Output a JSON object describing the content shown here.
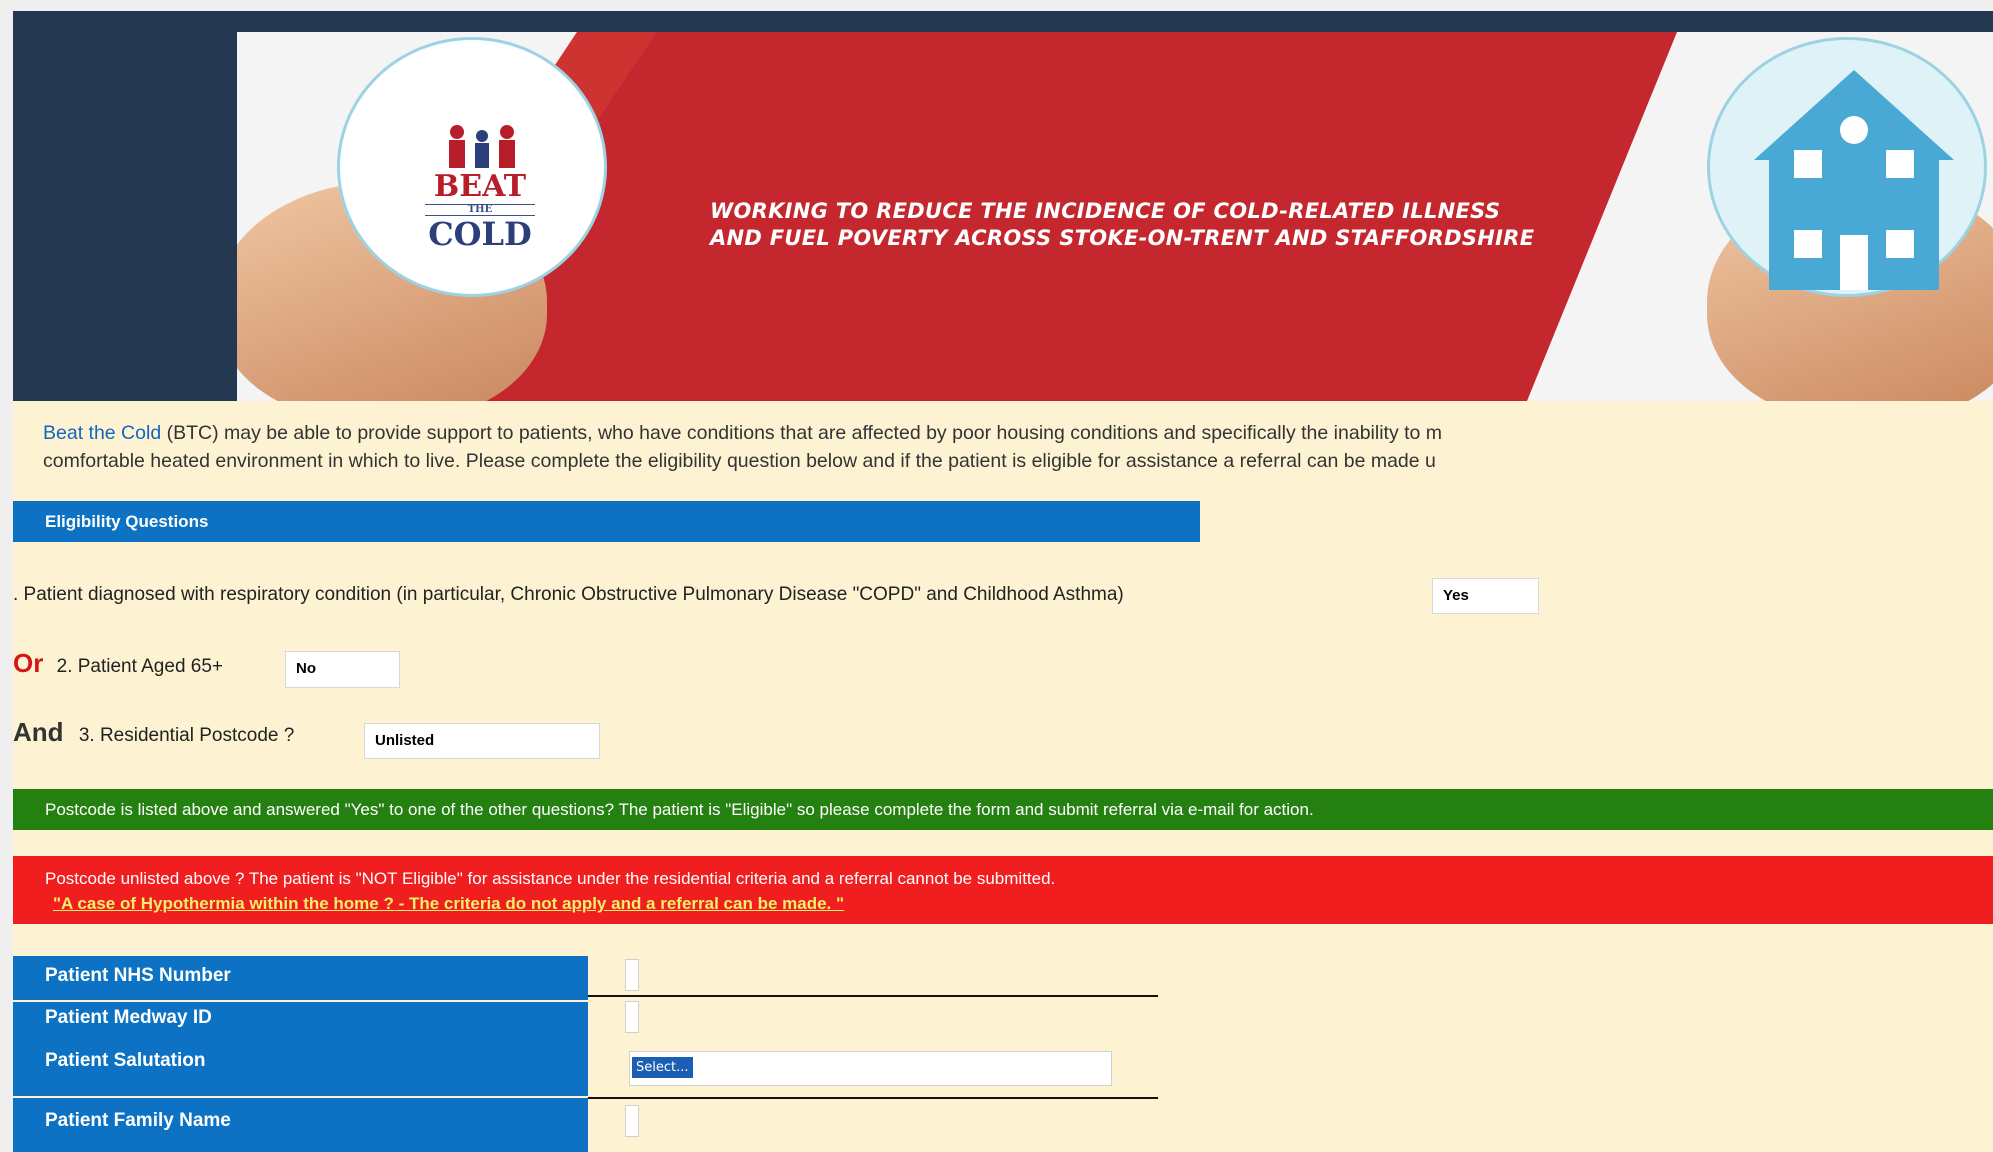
{
  "banner": {
    "logo": {
      "line1": "BEAT",
      "line2": "THE",
      "line3": "COLD"
    },
    "tagline_line1": "WORKING TO REDUCE THE INCIDENCE OF COLD-RELATED ILLNESS",
    "tagline_line2": "AND FUEL POVERTY ACROSS STOKE-ON-TRENT AND STAFFORDSHIRE",
    "colors": {
      "background": "#253851",
      "red": "#c4282e"
    }
  },
  "intro": {
    "link_text": "Beat the Cold",
    "line1_rest": " (BTC) may be able to provide support to patients, who have conditions that are affected by poor housing conditions and specifically the inability to m",
    "line2": "comfortable heated environment in which to live. Please complete the eligibility question below and if the patient is eligible for assistance a referral can be made u"
  },
  "eligibility": {
    "header": "Eligibility Questions",
    "q1": {
      "label": ". Patient diagnosed with respiratory condition (in particular, Chronic Obstructive Pulmonary Disease \"COPD\" and Childhood Asthma)",
      "value": "Yes"
    },
    "q2": {
      "connector": "Or",
      "label": "2. Patient Aged 65+",
      "value": "No"
    },
    "q3": {
      "connector": "And",
      "label": "3. Residential Postcode ?",
      "value": "Unlisted"
    }
  },
  "messages": {
    "eligible": "Postcode is listed above and answered \"Yes\" to one of the other questions? The patient is \"Eligible\" so please complete the form and submit referral via e-mail for action.",
    "not_eligible": "Postcode unlisted above ? The patient is \"NOT Eligible\" for assistance under the residential criteria and a referral cannot be submitted.",
    "hypothermia": "\"A case of Hypothermia within the home ?  -  The  criteria do not apply and a referral can be made. \"",
    "colors": {
      "green": "#258012",
      "red": "#f01e1e"
    }
  },
  "form": {
    "nhs_label": "Patient NHS Number",
    "medway_label": "Patient Medway ID",
    "salutation_label": "Patient Salutation",
    "salutation_value": "Select...",
    "family_name_label": "Patient Family Name"
  }
}
